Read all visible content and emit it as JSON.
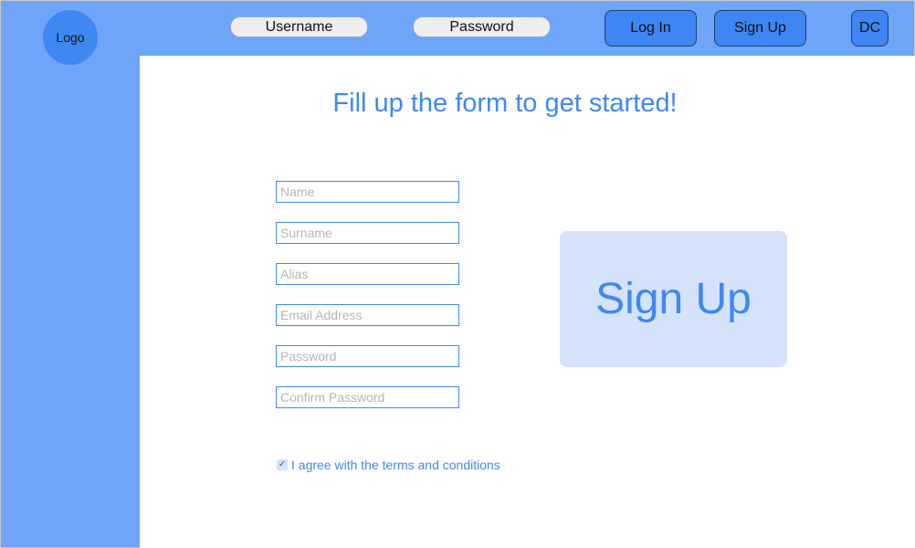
{
  "header": {
    "logo_label": "Logo",
    "username_label": "Username",
    "password_label": "Password",
    "login_label": "Log In",
    "signup_label": "Sign Up",
    "avatar_initials": "DC"
  },
  "main": {
    "headline": "Fill up the form to get started!",
    "fields": [
      {
        "placeholder": "Name",
        "value": ""
      },
      {
        "placeholder": "Surname",
        "value": ""
      },
      {
        "placeholder": "Alias",
        "value": ""
      },
      {
        "placeholder": "Email Address",
        "value": ""
      },
      {
        "placeholder": "Password",
        "value": ""
      },
      {
        "placeholder": "Confirm Password",
        "value": ""
      }
    ],
    "terms": {
      "checked": true,
      "check_glyph": "✓",
      "label": "I agree with the terms and conditions"
    },
    "signup_button_label": "Sign Up"
  },
  "colors": {
    "sidebar_blue": "#6fa5f9",
    "accent_blue": "#3f88f1",
    "light_blue": "#d4e3fb"
  }
}
